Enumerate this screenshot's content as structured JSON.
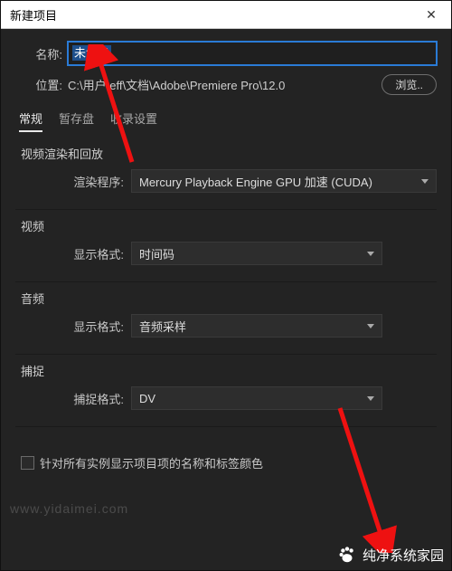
{
  "titlebar": {
    "title": "新建项目",
    "close_glyph": "✕"
  },
  "form": {
    "name_label": "名称:",
    "name_value": "未命名",
    "location_label": "位置:",
    "location_value": "C:\\用户\\eff\\文档\\Adobe\\Premiere Pro\\12.0",
    "browse_label": "浏览.."
  },
  "tabs": {
    "general": "常规",
    "scratch": "暂存盘",
    "ingest": "收录设置"
  },
  "groups": {
    "render": {
      "title": "视频渲染和回放",
      "renderer_label": "渲染程序:",
      "renderer_value": "Mercury Playback Engine GPU 加速 (CUDA)"
    },
    "video": {
      "title": "视频",
      "format_label": "显示格式:",
      "format_value": "时间码"
    },
    "audio": {
      "title": "音频",
      "format_label": "显示格式:",
      "format_value": "音频采样"
    },
    "capture": {
      "title": "捕捉",
      "format_label": "捕捉格式:",
      "format_value": "DV"
    }
  },
  "checkbox": {
    "label": "针对所有实例显示项目项的名称和标签颜色"
  },
  "watermarks": {
    "url": "www.yidaimei.com",
    "brand": "纯净系统家园"
  }
}
